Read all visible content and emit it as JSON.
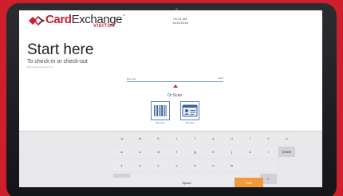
{
  "app": {
    "logo_card": "Card",
    "logo_exchange": "Exchange",
    "logo_tm": "™",
    "logo_visitor": "VISITOR"
  },
  "clock": {
    "time": "00:41 AM",
    "date": "11/11/2016"
  },
  "main": {
    "title": "Start here",
    "subtitle": "To check-in or check-out",
    "hint": "Enter a barcode number here..."
  },
  "search": {
    "placeholder": "Barcode",
    "go_label": "Send"
  },
  "scan": {
    "or_scan": "Or Scan",
    "options": [
      {
        "label": "Barcode",
        "icon": "barcode-icon"
      },
      {
        "label": "ID Card",
        "icon": "id-card-icon"
      }
    ]
  },
  "keyboard": {
    "row1": [
      "q",
      "w",
      "e",
      "r",
      "t",
      "y",
      "u",
      "i",
      "o",
      "p"
    ],
    "row2": [
      "a",
      "s",
      "d",
      "f",
      "g",
      "h",
      "j",
      "k",
      "l"
    ],
    "delete_label": "Delete",
    "row3": [
      "z",
      "x",
      "c",
      "v",
      "b",
      "n",
      "m",
      ",",
      "."
    ],
    "shift_label": "⇧",
    "shift_right_label": "⇧",
    "row4": [
      "@",
      "&",
      "#",
      "$",
      "'",
      "-",
      "/",
      ".",
      "?"
    ],
    "enter_label": "↵",
    "space_label": "Space",
    "hide_label": "Hide"
  },
  "colors": {
    "brand_red": "#c8202f",
    "accent_blue": "#4a72b0",
    "hide_orange": "#f39a3a"
  }
}
